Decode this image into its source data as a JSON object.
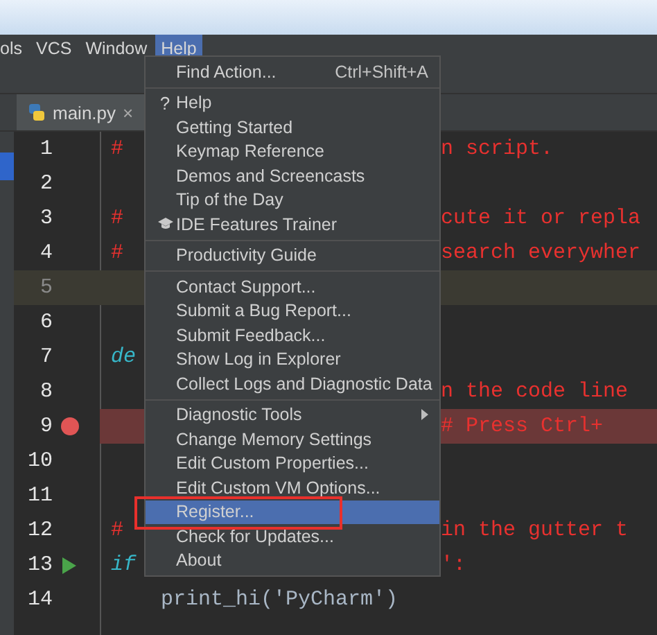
{
  "menu_bar": [
    {
      "label": "ols",
      "selected": false
    },
    {
      "label": "VCS",
      "selected": false
    },
    {
      "label": "Window",
      "selected": false
    },
    {
      "label": "Help",
      "selected": true
    }
  ],
  "tabs": [
    {
      "label": "main.py",
      "close": "×",
      "selected": true
    }
  ],
  "editor": {
    "lines": [
      {
        "number": "1",
        "kind": "plain",
        "left": {
          "text": "#",
          "kind": "comment"
        },
        "right": "n script."
      },
      {
        "number": "2",
        "kind": "plain"
      },
      {
        "number": "3",
        "kind": "plain",
        "left": {
          "text": "#",
          "kind": "comment"
        },
        "right": "cute it or repla"
      },
      {
        "number": "4",
        "kind": "plain",
        "left": {
          "text": "#",
          "kind": "comment"
        },
        "right": "search everywher"
      },
      {
        "number": "5",
        "kind": "current"
      },
      {
        "number": "6",
        "kind": "plain"
      },
      {
        "number": "7",
        "kind": "plain",
        "left": {
          "text": "de",
          "kind": "keyword"
        }
      },
      {
        "number": "8",
        "kind": "plain",
        "right": "n the code line"
      },
      {
        "number": "9",
        "kind": "breakpoint",
        "right": "# Press Ctrl+"
      },
      {
        "number": "10",
        "kind": "plain"
      },
      {
        "number": "11",
        "kind": "plain"
      },
      {
        "number": "12",
        "kind": "plain",
        "left": {
          "text": "#",
          "kind": "comment"
        },
        "right": "in the gutter t"
      },
      {
        "number": "13",
        "kind": "run",
        "left": {
          "text": "if",
          "kind": "keyword"
        },
        "right": "':"
      },
      {
        "number": "14",
        "kind": "plain",
        "left": {
          "text": "    print_hi('PyCharm')",
          "kind": "call"
        }
      }
    ]
  },
  "help_menu": {
    "sections": [
      {
        "items": [
          {
            "label": "Find Action...",
            "shortcut": "Ctrl+Shift+A",
            "selected": false
          }
        ]
      },
      {
        "items": [
          {
            "label": "Help",
            "icon_text": "?",
            "selected": false
          },
          {
            "label": "Getting Started",
            "selected": false
          },
          {
            "label": "Keymap Reference",
            "selected": false
          },
          {
            "label": "Demos and Screencasts",
            "selected": false
          },
          {
            "label": "Tip of the Day",
            "selected": false
          },
          {
            "label": "IDE Features Trainer",
            "kind": "trainer",
            "selected": false
          }
        ]
      },
      {
        "items": [
          {
            "label": "Productivity Guide",
            "selected": false
          }
        ]
      },
      {
        "items": [
          {
            "label": "Contact Support...",
            "selected": false
          },
          {
            "label": "Submit a Bug Report...",
            "selected": false
          },
          {
            "label": "Submit Feedback...",
            "selected": false
          },
          {
            "label": "Show Log in Explorer",
            "selected": false
          },
          {
            "label": "Collect Logs and Diagnostic Data",
            "selected": false
          }
        ]
      },
      {
        "items": [
          {
            "label": "Diagnostic Tools",
            "kind": "submenu",
            "selected": false
          },
          {
            "label": "Change Memory Settings",
            "selected": false
          },
          {
            "label": "Edit Custom Properties...",
            "selected": false
          },
          {
            "label": "Edit Custom VM Options...",
            "selected": false
          },
          {
            "label": "Register...",
            "selected": true,
            "annotated": true
          },
          {
            "label": "Check for Updates...",
            "selected": false
          },
          {
            "label": "About",
            "selected": false
          }
        ]
      }
    ]
  }
}
